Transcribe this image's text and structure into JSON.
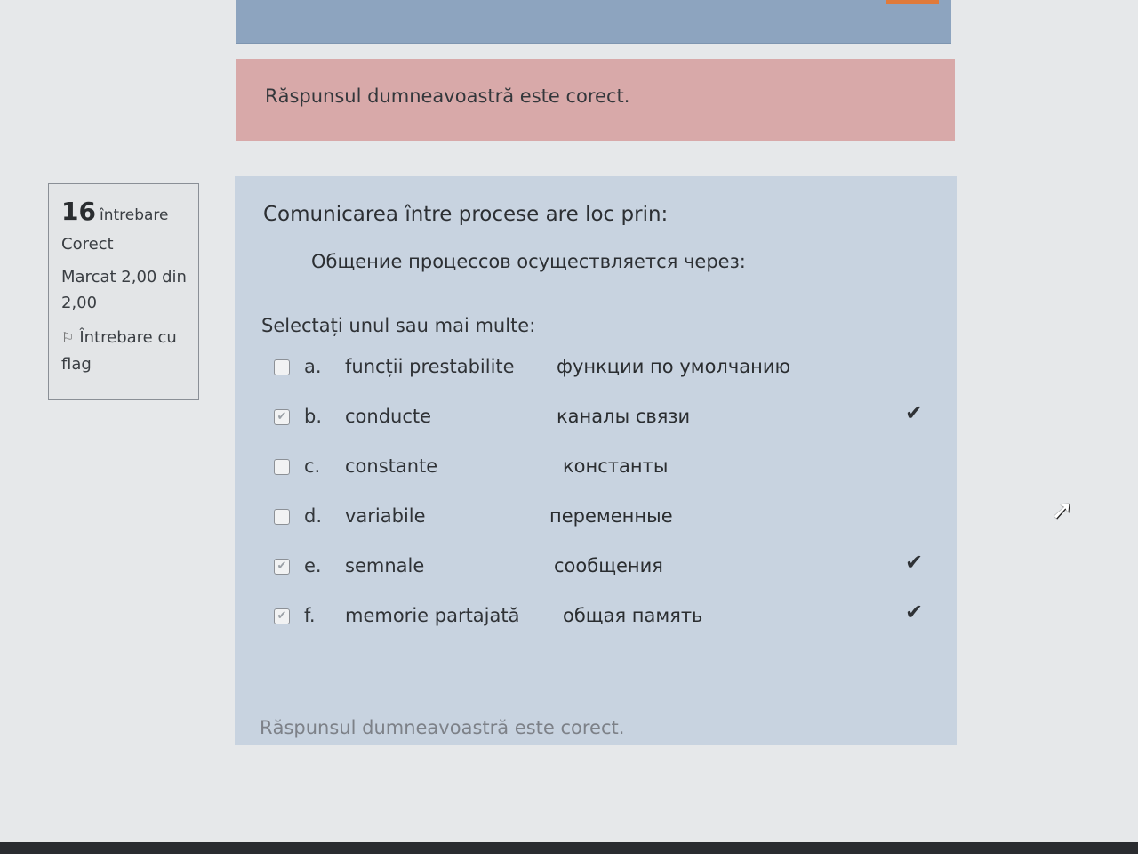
{
  "feedback_top": "Răspunsul dumneavoastră este corect.",
  "info": {
    "number": "16",
    "word": "întrebare",
    "state": "Corect",
    "grade": "Marcat 2,00 din 2,00",
    "flag_label": "Întrebare cu flag"
  },
  "question": {
    "text": "Comunicarea între procese are loc prin:",
    "text_ru": "Общение процессов  осуществляется через:",
    "prompt": "Selectați unul sau mai multe:"
  },
  "options": [
    {
      "letter": "a.",
      "label": "funcții prestabilite",
      "ru": "функции по умолчанию",
      "checked": false,
      "mark": ""
    },
    {
      "letter": "b.",
      "label": "conducte",
      "ru": "каналы связи",
      "checked": true,
      "mark": "✔"
    },
    {
      "letter": "c.",
      "label": "constante",
      "ru": "константы",
      "checked": false,
      "mark": ""
    },
    {
      "letter": "d.",
      "label": "variabile",
      "ru": "переменные",
      "checked": false,
      "mark": ""
    },
    {
      "letter": "e.",
      "label": "semnale",
      "ru": "сообщения",
      "checked": true,
      "mark": "✔"
    },
    {
      "letter": "f.",
      "label": "memorie partajată",
      "ru": "общая память",
      "checked": true,
      "mark": "✔"
    }
  ],
  "feedback_bottom": "Răspunsul dumneavoastră este corect.",
  "icons": {
    "flag": "flag-icon",
    "checkmark": "check-icon",
    "cursor": "mouse-cursor-icon"
  },
  "colors": {
    "feedback_bg": "#d8a9a9",
    "content_bg": "#c8d3e0",
    "top_card_bg": "#8da4bf"
  }
}
